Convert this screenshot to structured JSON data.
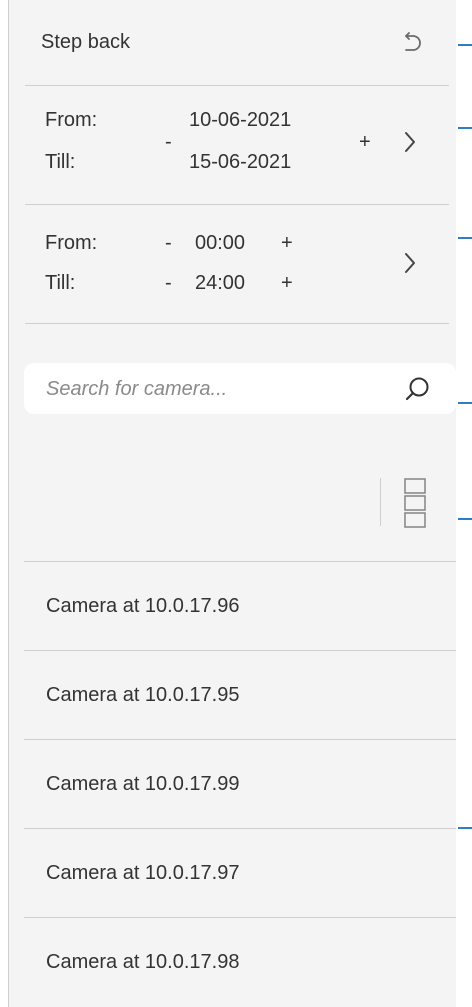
{
  "step_back": {
    "label": "Step back"
  },
  "date_range": {
    "from_label": "From:",
    "till_label": "Till:",
    "minus": "-",
    "plus": "+",
    "from_value": "10-06-2021",
    "till_value": "15-06-2021"
  },
  "time_range": {
    "from_label": "From:",
    "till_label": "Till:",
    "minus": "-",
    "plus": "+",
    "from_value": "00:00",
    "till_value": "24:00"
  },
  "search": {
    "placeholder": "Search for camera..."
  },
  "cameras": [
    {
      "label": "Camera at 10.0.17.96"
    },
    {
      "label": "Camera at 10.0.17.95"
    },
    {
      "label": "Camera at 10.0.17.99"
    },
    {
      "label": "Camera at 10.0.17.97"
    },
    {
      "label": "Camera at 10.0.17.98"
    }
  ],
  "colors": {
    "panel_bg": "#f4f4f4",
    "divider": "#cfcfcf",
    "accent": "#2f7fc0",
    "text": "#333333",
    "placeholder": "#8a8a8a"
  }
}
